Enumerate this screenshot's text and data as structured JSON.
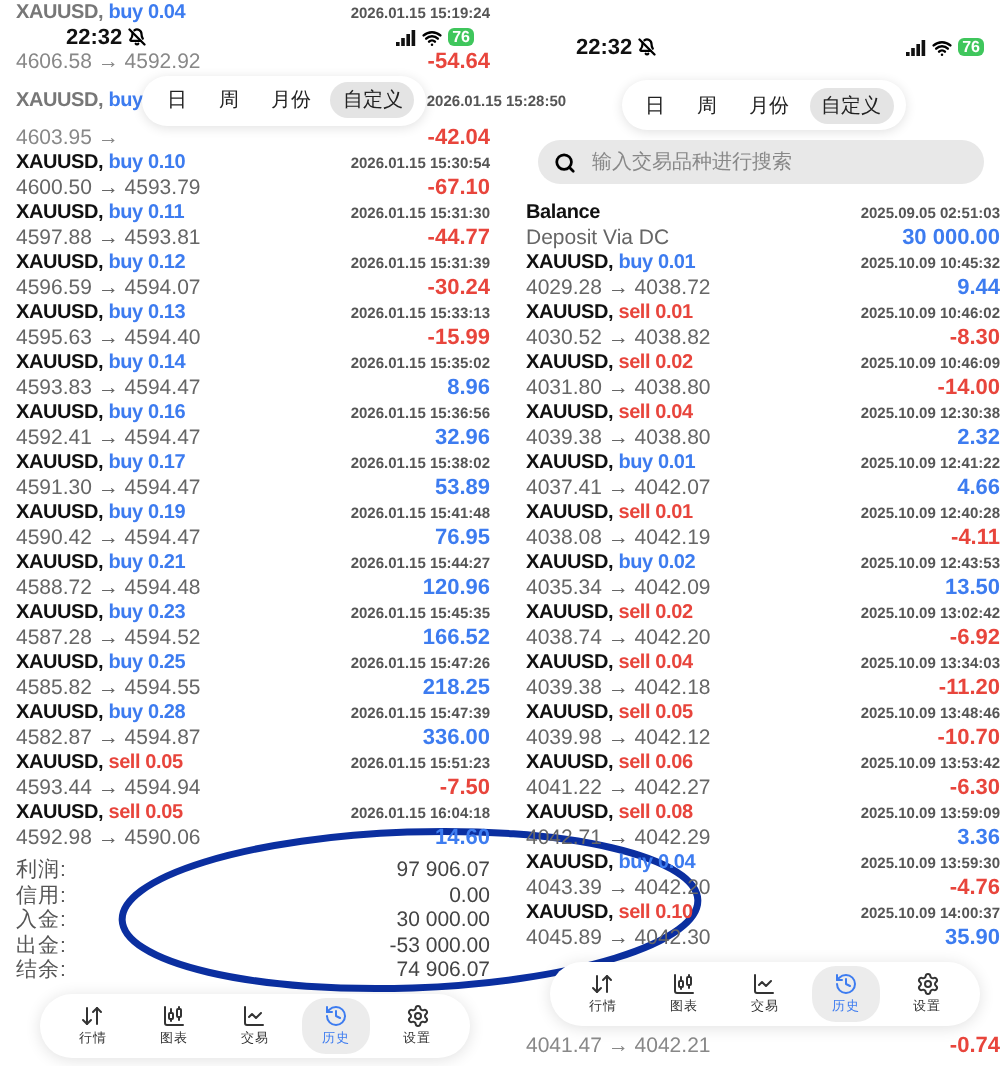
{
  "screens": [
    {
      "status": {
        "time": "22:32",
        "battery": "76"
      },
      "period_tabs": [
        {
          "label": "日",
          "selected": false
        },
        {
          "label": "周",
          "selected": false
        },
        {
          "label": "月份",
          "selected": false
        },
        {
          "label": "自定义",
          "selected": true
        }
      ],
      "top_rows": [
        {
          "kind": "buy",
          "symbol": "XAUUSD,",
          "side": "buy 0.04",
          "prices": "4606.58 → 4592.92",
          "time": "2026.01.15 15:19:24",
          "profit": "-54.64",
          "color": "#e8453c"
        },
        {
          "kind": "buy",
          "symbol": "XAUUSD,",
          "side": "buy",
          "prices": "4603.95 →",
          "time": "2026.01.15 15:28:50",
          "profit": "-42.04",
          "color": "#e8453c"
        }
      ],
      "trades": [
        {
          "kind": "buy",
          "symbol": "XAUUSD,",
          "side": "buy 0.10",
          "prices": "4600.50 → 4593.79",
          "time": "2026.01.15 15:30:54",
          "profit": "-67.10",
          "color": "#e8453c"
        },
        {
          "kind": "buy",
          "symbol": "XAUUSD,",
          "side": "buy 0.11",
          "prices": "4597.88 → 4593.81",
          "time": "2026.01.15 15:31:30",
          "profit": "-44.77",
          "color": "#e8453c"
        },
        {
          "kind": "buy",
          "symbol": "XAUUSD,",
          "side": "buy 0.12",
          "prices": "4596.59 → 4594.07",
          "time": "2026.01.15 15:31:39",
          "profit": "-30.24",
          "color": "#e8453c"
        },
        {
          "kind": "buy",
          "symbol": "XAUUSD,",
          "side": "buy 0.13",
          "prices": "4595.63 → 4594.40",
          "time": "2026.01.15 15:33:13",
          "profit": "-15.99",
          "color": "#e8453c"
        },
        {
          "kind": "buy",
          "symbol": "XAUUSD,",
          "side": "buy 0.14",
          "prices": "4593.83 → 4594.47",
          "time": "2026.01.15 15:35:02",
          "profit": "8.96",
          "color": "#3d7cf0"
        },
        {
          "kind": "buy",
          "symbol": "XAUUSD,",
          "side": "buy 0.16",
          "prices": "4592.41 → 4594.47",
          "time": "2026.01.15 15:36:56",
          "profit": "32.96",
          "color": "#3d7cf0"
        },
        {
          "kind": "buy",
          "symbol": "XAUUSD,",
          "side": "buy 0.17",
          "prices": "4591.30 → 4594.47",
          "time": "2026.01.15 15:38:02",
          "profit": "53.89",
          "color": "#3d7cf0"
        },
        {
          "kind": "buy",
          "symbol": "XAUUSD,",
          "side": "buy 0.19",
          "prices": "4590.42 → 4594.47",
          "time": "2026.01.15 15:41:48",
          "profit": "76.95",
          "color": "#3d7cf0"
        },
        {
          "kind": "buy",
          "symbol": "XAUUSD,",
          "side": "buy 0.21",
          "prices": "4588.72 → 4594.48",
          "time": "2026.01.15 15:44:27",
          "profit": "120.96",
          "color": "#3d7cf0"
        },
        {
          "kind": "buy",
          "symbol": "XAUUSD,",
          "side": "buy 0.23",
          "prices": "4587.28 → 4594.52",
          "time": "2026.01.15 15:45:35",
          "profit": "166.52",
          "color": "#3d7cf0"
        },
        {
          "kind": "buy",
          "symbol": "XAUUSD,",
          "side": "buy 0.25",
          "prices": "4585.82 → 4594.55",
          "time": "2026.01.15 15:47:26",
          "profit": "218.25",
          "color": "#3d7cf0"
        },
        {
          "kind": "buy",
          "symbol": "XAUUSD,",
          "side": "buy 0.28",
          "prices": "4582.87 → 4594.87",
          "time": "2026.01.15 15:47:39",
          "profit": "336.00",
          "color": "#3d7cf0"
        },
        {
          "kind": "sell",
          "symbol": "XAUUSD,",
          "side": "sell 0.05",
          "prices": "4593.44 → 4594.94",
          "time": "2026.01.15 15:51:23",
          "profit": "-7.50",
          "color": "#e8453c"
        },
        {
          "kind": "sell",
          "symbol": "XAUUSD,",
          "side": "sell 0.05",
          "prices": "4592.98 → 4590.06",
          "time": "2026.01.15 16:04:18",
          "profit": "14.60",
          "color": "#3d7cf0"
        }
      ],
      "summary": [
        {
          "label": "利润:",
          "value": "97 906.07"
        },
        {
          "label": "信用:",
          "value": "0.00"
        },
        {
          "label": "入金:",
          "value": "30 000.00"
        },
        {
          "label": "出金:",
          "value": "-53 000.00"
        },
        {
          "label": "结余:",
          "value": "74 906.07"
        }
      ],
      "nav": [
        {
          "label": "行情",
          "selected": false
        },
        {
          "label": "图表",
          "selected": false
        },
        {
          "label": "交易",
          "selected": false
        },
        {
          "label": "历史",
          "selected": true
        },
        {
          "label": "设置",
          "selected": false
        }
      ]
    },
    {
      "status": {
        "time": "22:32",
        "battery": "76"
      },
      "period_tabs": [
        {
          "label": "日",
          "selected": false
        },
        {
          "label": "周",
          "selected": false
        },
        {
          "label": "月份",
          "selected": false
        },
        {
          "label": "自定义",
          "selected": true
        }
      ],
      "search": {
        "placeholder": "输入交易品种进行搜索"
      },
      "trades": [
        {
          "kind": "balance",
          "symbol": "Balance",
          "prices": "Deposit Via DC",
          "time": "2025.09.05 02:51:03",
          "profit": "30 000.00",
          "color": "#3d7cf0"
        },
        {
          "kind": "buy",
          "symbol": "XAUUSD,",
          "side": "buy 0.01",
          "prices": "4029.28 → 4038.72",
          "time": "2025.10.09 10:45:32",
          "profit": "9.44",
          "color": "#3d7cf0"
        },
        {
          "kind": "sell",
          "symbol": "XAUUSD,",
          "side": "sell 0.01",
          "prices": "4030.52 → 4038.82",
          "time": "2025.10.09 10:46:02",
          "profit": "-8.30",
          "color": "#e8453c"
        },
        {
          "kind": "sell",
          "symbol": "XAUUSD,",
          "side": "sell 0.02",
          "prices": "4031.80 → 4038.80",
          "time": "2025.10.09 10:46:09",
          "profit": "-14.00",
          "color": "#e8453c"
        },
        {
          "kind": "sell",
          "symbol": "XAUUSD,",
          "side": "sell 0.04",
          "prices": "4039.38 → 4038.80",
          "time": "2025.10.09 12:30:38",
          "profit": "2.32",
          "color": "#3d7cf0"
        },
        {
          "kind": "buy",
          "symbol": "XAUUSD,",
          "side": "buy 0.01",
          "prices": "4037.41 → 4042.07",
          "time": "2025.10.09 12:41:22",
          "profit": "4.66",
          "color": "#3d7cf0"
        },
        {
          "kind": "sell",
          "symbol": "XAUUSD,",
          "side": "sell 0.01",
          "prices": "4038.08 → 4042.19",
          "time": "2025.10.09 12:40:28",
          "profit": "-4.11",
          "color": "#e8453c"
        },
        {
          "kind": "buy",
          "symbol": "XAUUSD,",
          "side": "buy 0.02",
          "prices": "4035.34 → 4042.09",
          "time": "2025.10.09 12:43:53",
          "profit": "13.50",
          "color": "#3d7cf0"
        },
        {
          "kind": "sell",
          "symbol": "XAUUSD,",
          "side": "sell 0.02",
          "prices": "4038.74 → 4042.20",
          "time": "2025.10.09 13:02:42",
          "profit": "-6.92",
          "color": "#e8453c"
        },
        {
          "kind": "sell",
          "symbol": "XAUUSD,",
          "side": "sell 0.04",
          "prices": "4039.38 → 4042.18",
          "time": "2025.10.09 13:34:03",
          "profit": "-11.20",
          "color": "#e8453c"
        },
        {
          "kind": "sell",
          "symbol": "XAUUSD,",
          "side": "sell 0.05",
          "prices": "4039.98 → 4042.12",
          "time": "2025.10.09 13:48:46",
          "profit": "-10.70",
          "color": "#e8453c"
        },
        {
          "kind": "sell",
          "symbol": "XAUUSD,",
          "side": "sell 0.06",
          "prices": "4041.22 → 4042.27",
          "time": "2025.10.09 13:53:42",
          "profit": "-6.30",
          "color": "#e8453c"
        },
        {
          "kind": "sell",
          "symbol": "XAUUSD,",
          "side": "sell 0.08",
          "prices": "4042.71 → 4042.29",
          "time": "2025.10.09 13:59:09",
          "profit": "3.36",
          "color": "#3d7cf0"
        },
        {
          "kind": "buy",
          "symbol": "XAUUSD,",
          "side": "buy 0.04",
          "prices": "4043.39 → 4042.20",
          "time": "2025.10.09 13:59:30",
          "profit": "-4.76",
          "color": "#e8453c"
        },
        {
          "kind": "sell",
          "symbol": "XAUUSD,",
          "side": "sell 0.10",
          "prices": "4045.89 → 4042.30",
          "time": "2025.10.09 14:00:37",
          "profit": "35.90",
          "color": "#3d7cf0"
        }
      ],
      "nav": [
        {
          "label": "行情",
          "selected": false
        },
        {
          "label": "图表",
          "selected": false
        },
        {
          "label": "交易",
          "selected": false
        },
        {
          "label": "历史",
          "selected": true
        },
        {
          "label": "设置",
          "selected": false
        }
      ],
      "bottom_rows": [
        {
          "prices": "4041.47 → 4042.21",
          "profit": "-0.74",
          "color": "#e8453c"
        }
      ]
    }
  ],
  "annotation": {
    "kind": "ellipse"
  }
}
